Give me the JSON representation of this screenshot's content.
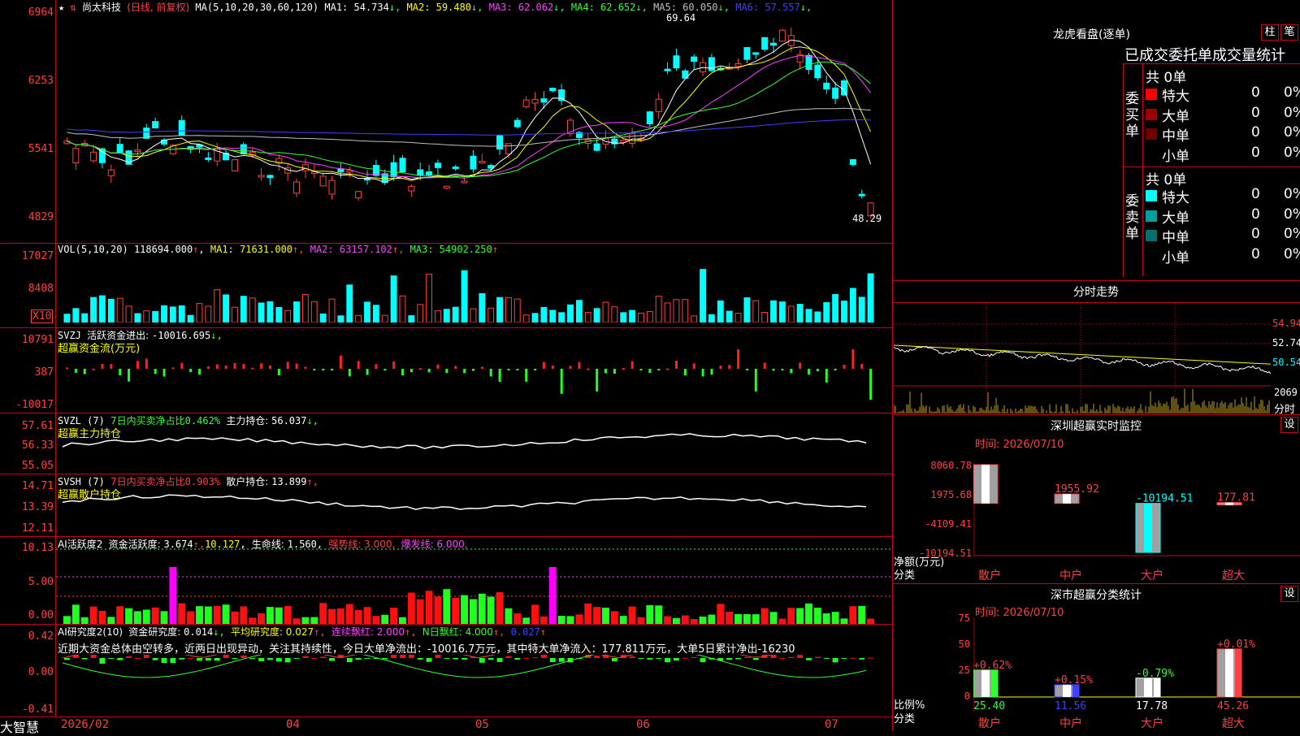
{
  "stock": {
    "star": "★",
    "name": "尚太科技",
    "period": "(日线, 前复权)",
    "ma_label": "MA(5,10,20,30,60,120)",
    "ma_values": [
      {
        "label": "MA1: ",
        "value": "54.734",
        "arrow": "↓",
        "color": "#ffffff"
      },
      {
        "label": "MA2: ",
        "value": "59.480",
        "arrow": "↓",
        "color": "#ffff00"
      },
      {
        "label": "MA3: ",
        "value": "62.062",
        "arrow": "↓",
        "color": "#ff40ff"
      },
      {
        "label": "MA4: ",
        "value": "62.652",
        "arrow": "↓",
        "color": "#33ff33"
      },
      {
        "label": "MA5: ",
        "value": "60.050",
        "arrow": "↓",
        "color": "#c0c0c0"
      },
      {
        "label": "MA6: ",
        "value": "57.557",
        "arrow": "↓",
        "color": "#4040ff"
      }
    ]
  },
  "price_axis": [
    "6964",
    "6253",
    "5541",
    "4829"
  ],
  "price_annotations": {
    "high": "69.64",
    "low": "48.29"
  },
  "vol": {
    "label": "VOL(5,10,20)",
    "value": "118694.000",
    "arrow": "↑",
    "ma": [
      {
        "label": "MA1: ",
        "value": "71631.000",
        "arrow": "↑",
        "color": "#ffff00"
      },
      {
        "label": "MA2: ",
        "value": "63157.102",
        "arrow": "↑",
        "color": "#ff40ff"
      },
      {
        "label": "MA3: ",
        "value": "54902.250",
        "arrow": "↑",
        "color": "#33ff33"
      }
    ],
    "axis": [
      "17027",
      "8408"
    ],
    "unit": "X10"
  },
  "svzj": {
    "label": "SVZJ",
    "desc": "活跃资金进出: ",
    "value": "-10016.695",
    "arrow": "↓,",
    "subtitle": "超赢资金流(万元)",
    "axis": [
      "10791",
      "387",
      "-10017"
    ]
  },
  "svzl": {
    "label": "SVZL (7)",
    "desc": "7日内买卖净占比",
    "desc_val": "0.462%",
    "desc2": "主力持仓: ",
    "value": "56.037",
    "arrow": "↓,",
    "subtitle": "超赢主力持仓",
    "axis": [
      "57.61",
      "56.33",
      "55.05"
    ]
  },
  "svsh": {
    "label": "SVSH (7)",
    "desc": "7日内买卖净占比",
    "desc_val": "0.903%",
    "desc2": "散户持仓: ",
    "value": "13.899",
    "arrow": "↑,",
    "subtitle": "超赢散户持仓",
    "axis": [
      "14.71",
      "13.39",
      "12.11"
    ]
  },
  "ai_active": {
    "label": "AI活跃度2",
    "desc": "资金活跃度: ",
    "value": "3.674",
    "arrow": "↑,",
    "v2": "10.127",
    "v2_arrow": ",",
    "life": "生命线: ",
    "life_val": "1.560",
    "strong": "强势线: 3.000,",
    "burst": "爆发线: 6.000,",
    "axis": [
      "10.13",
      "5.00",
      "0.00"
    ]
  },
  "ai_research": {
    "label": "AI研究度2(10)",
    "desc": "资金研究度: ",
    "value": "0.014",
    "arrow": "↓,",
    "avg": "平均研究度: 0.027",
    "avg_arrow": "↑,",
    "cont": "连续飘红: 2.000",
    "cont_arrow": "↑,",
    "nday": "N日飘红: 4.000",
    "nday_arrow": "↑,",
    "last": "0.027",
    "last_arrow": "↑",
    "comment": "近期大资金总体由空转多，近两日出现异动，关注其持续性，今日大单净流出：-10016.7万元，其中特大单净流入：177.811万元，大单5日累计净出-16230",
    "axis": [
      "0.42",
      "0.00",
      "-0.41"
    ]
  },
  "date_axis": {
    "logo": "大智慧",
    "labels": [
      "2026/02",
      "04",
      "05",
      "06",
      "07"
    ]
  },
  "right": {
    "dragon_title": "龙虎看盘(逐单)",
    "btn_bar": "柱",
    "btn_tick": "笔",
    "stat_header": "已成交委托单成交量统计",
    "buy": {
      "side": "委买单",
      "total": "共 0单",
      "rows": [
        {
          "name": "特大",
          "count": "0",
          "pct": "0%",
          "color": "#ff0000"
        },
        {
          "name": "大单",
          "count": "0",
          "pct": "0%",
          "color": "#a00000"
        },
        {
          "name": "中单",
          "count": "0",
          "pct": "0%",
          "color": "#700000"
        },
        {
          "name": "小单",
          "count": "0",
          "pct": "0%",
          "color": "#000000"
        }
      ]
    },
    "sell": {
      "side": "委卖单",
      "total": "共 0单",
      "rows": [
        {
          "name": "特大",
          "count": "0",
          "pct": "0%",
          "color": "#00ffff"
        },
        {
          "name": "大单",
          "count": "0",
          "pct": "0%",
          "color": "#00a0a0"
        },
        {
          "name": "中单",
          "count": "0",
          "pct": "0%",
          "color": "#007070"
        },
        {
          "name": "小单",
          "count": "0",
          "pct": "0%",
          "color": "#000000"
        }
      ]
    },
    "intraday": {
      "title": "分时走势",
      "axis": [
        "54.94",
        "52.74",
        "50.54"
      ],
      "vol_axis": [
        "2069"
      ],
      "unit": "分时"
    },
    "monitor": {
      "title": "深圳超赢实时监控",
      "set": "设",
      "time": "时间: 2026/07/10",
      "axis": [
        "8060.78",
        "1975.68",
        "-4109.41",
        "-10194.51"
      ],
      "ylabel": "净额(万元)",
      "xlabel": "分类",
      "bars": [
        {
          "cat": "散户",
          "value": "8060.78",
          "color": "#ff4040"
        },
        {
          "cat": "中户",
          "value": "1955.92",
          "color": "#ff4040"
        },
        {
          "cat": "大户",
          "value": "-10194.51",
          "color": "#00ffff"
        },
        {
          "cat": "超大",
          "value": "177.81",
          "color": "#ff4040"
        }
      ]
    },
    "classify": {
      "title": "深市超赢分类统计",
      "set": "设",
      "time": "时间: 2026/07/10",
      "axis": [
        "75",
        "50",
        "25",
        "0"
      ],
      "ylabel": "比例%",
      "xlabel": "分类",
      "bars": [
        {
          "cat": "散户",
          "change": "+0.62%",
          "value": "25.40",
          "change_color": "#ff4040",
          "value_color": "#33ff33"
        },
        {
          "cat": "中户",
          "change": "+0.15%",
          "value": "11.56",
          "change_color": "#ff4040",
          "value_color": "#4040ff"
        },
        {
          "cat": "大户",
          "change": "-0.79%",
          "value": "17.78",
          "change_color": "#33ff33",
          "value_color": "#ffffff"
        },
        {
          "cat": "超大",
          "change": "+0.01%",
          "value": "45.26",
          "change_color": "#ff4040",
          "value_color": "#ff4040"
        }
      ]
    }
  }
}
